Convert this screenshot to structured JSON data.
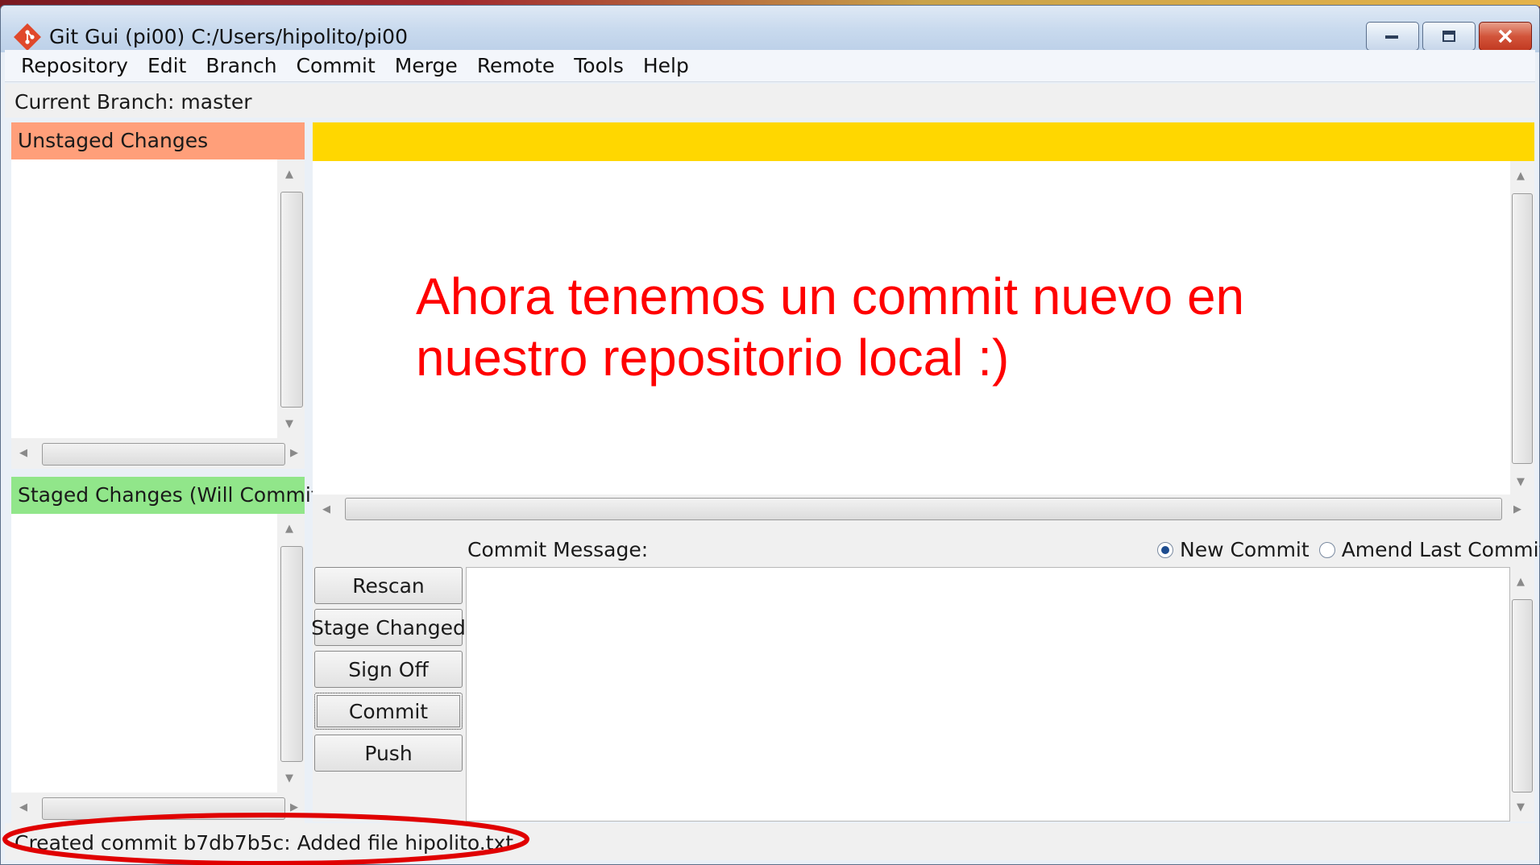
{
  "window": {
    "title": "Git Gui (pi00) C:/Users/hipolito/pi00"
  },
  "menu": [
    "Repository",
    "Edit",
    "Branch",
    "Commit",
    "Merge",
    "Remote",
    "Tools",
    "Help"
  ],
  "branch": {
    "label": "Current Branch: master"
  },
  "unstaged": {
    "header": "Unstaged Changes",
    "color": "#ff9f7a"
  },
  "staged": {
    "header": "Staged Changes (Will Commit)",
    "color": "#91e68a"
  },
  "diff": {
    "header_color": "#ffd700"
  },
  "annotation": {
    "line1": "Ahora tenemos un commit nuevo en",
    "line2": "nuestro repositorio local :)",
    "color": "#ff0000"
  },
  "commit": {
    "message_label": "Commit Message:",
    "new_commit_label": "New Commit",
    "amend_label": "Amend Last Commit",
    "selected_mode": "New Commit",
    "buttons": [
      "Rescan",
      "Stage Changed",
      "Sign Off",
      "Commit",
      "Push"
    ]
  },
  "status": {
    "text": "Created commit b7db7b5c: Added file hipolito.txt"
  }
}
